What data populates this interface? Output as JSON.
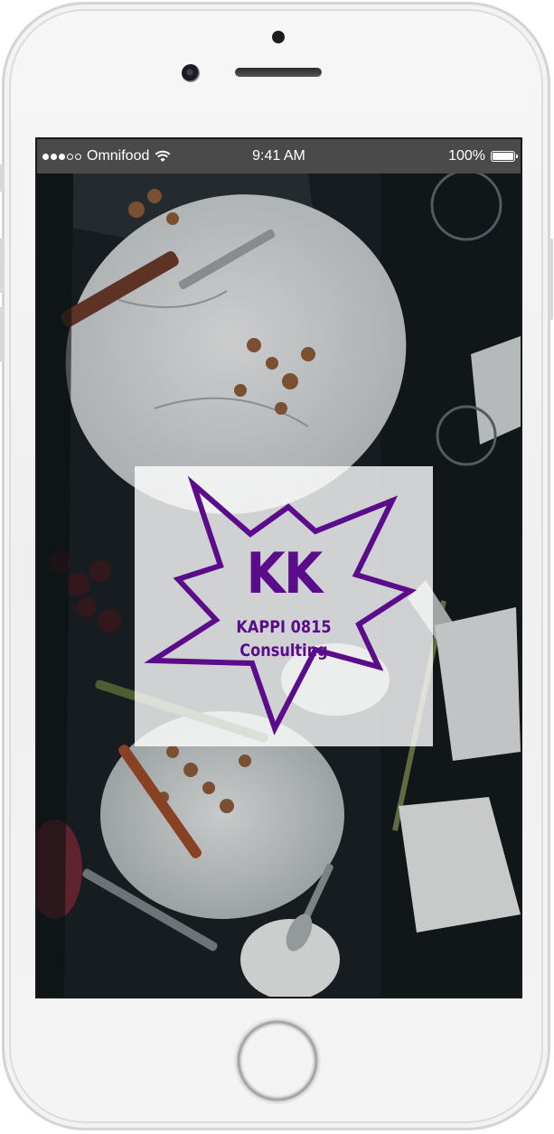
{
  "status_bar": {
    "carrier": "Omnifood",
    "time": "9:41 AM",
    "battery_percent": "100%",
    "signal_bars_filled": 3,
    "signal_bars_total": 5
  },
  "logo": {
    "monogram": "KK",
    "name": "KAPPI 0815",
    "tagline": "Consulting",
    "color": "#5b0c8a"
  },
  "icons": {
    "wifi": "wifi-icon",
    "battery": "battery-icon",
    "signal": "signal-icon"
  }
}
